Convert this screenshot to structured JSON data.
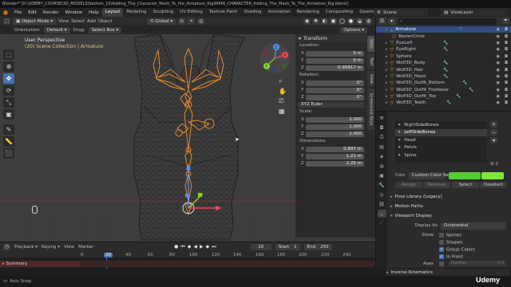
{
  "window": {
    "title": "Blender* [D:\\UDEMY_COURSE\\3D_MODELS\\Section_10\\Adding_The_Character_Mesh_To_the_Armature_Rig\\MAIN_CHARACTER_Adding_The_Mesh_To_The_Armature_Rig.blend]"
  },
  "menus": [
    "File",
    "Edit",
    "Render",
    "Window",
    "Help"
  ],
  "workspaces": [
    "Layout",
    "Modeling",
    "Sculpting",
    "UV Editing",
    "Texture Paint",
    "Shading",
    "Animation",
    "Rendering",
    "Compositing",
    "Geometry Nodes"
  ],
  "scene_name": "Scene",
  "view_layer": "ViewLayer",
  "viewport": {
    "mode": "Object Mode",
    "menus": [
      "View",
      "Select",
      "Add",
      "Object"
    ],
    "transform_orientation": "Global",
    "orientation_label": "Orientation:",
    "orientation_value": "Default",
    "drag_label": "Drag:",
    "drag_value": "Select Box",
    "options": "Options",
    "overlay_title": "User Perspective",
    "overlay_sub": "(20) Scene Collection | Armature",
    "gizmo": {
      "x": "X",
      "y": "Y",
      "z": "Z"
    }
  },
  "npanel": {
    "header": "Transform",
    "location_label": "Location:",
    "location": [
      {
        "axis": "X",
        "value": "0 m"
      },
      {
        "axis": "Y",
        "value": "0 m"
      },
      {
        "axis": "Z",
        "value": "0.95817 m"
      }
    ],
    "rotation_label": "Rotation:",
    "rotation": [
      {
        "axis": "X",
        "value": "0°"
      },
      {
        "axis": "Y",
        "value": "0°"
      },
      {
        "axis": "Z",
        "value": "0°"
      }
    ],
    "rotation_mode": "XYZ Euler",
    "scale_label": "Scale:",
    "scale": [
      {
        "axis": "X",
        "value": "1.000"
      },
      {
        "axis": "Y",
        "value": "1.000"
      },
      {
        "axis": "Z",
        "value": "1.000"
      }
    ],
    "dimensions_label": "Dimensions:",
    "dimensions": [
      {
        "axis": "X",
        "value": "0.897 m"
      },
      {
        "axis": "Y",
        "value": "1.21 m"
      },
      {
        "axis": "Z",
        "value": "2.25 m"
      }
    ],
    "tabs": [
      "Item",
      "Tool",
      "View",
      "Screencast Keys"
    ]
  },
  "outliner": {
    "items": [
      "Armature",
      "BezierCircle",
      "EyeLeft",
      "EyeRight",
      "Sphere",
      "Wolf3D_Body",
      "Wolf3D_Hair",
      "Wolf3D_Head",
      "Wolf3D_Outfit_Bottom",
      "Wolf3D_Outfit_Footwear",
      "Wolf3D_Outfit_Top",
      "Wolf3D_Teeth"
    ],
    "selected_index": 0
  },
  "properties": {
    "bone_groups": [
      "RightSideBones",
      "LeftSideBones",
      "Head",
      "Pelvis",
      "Spine"
    ],
    "selected_group_index": 1,
    "color_label": "Colo",
    "color_set": "Custom Color Set",
    "color_swatch": "#55cc33",
    "buttons": {
      "assign": "Assign",
      "remove": "Remove",
      "select": "Select",
      "deselect": "Deselect"
    },
    "pose_library": "Pose Library (Legacy)",
    "motion_paths": "Motion Paths",
    "viewport_display": "Viewport Display",
    "display_as_label": "Display As",
    "display_as_value": "Octahedral",
    "show_label": "Show",
    "show_items": [
      "Names",
      "Shapes",
      "Group Colors",
      "In Front"
    ],
    "axes_label": "Axes",
    "axes_position": "Position",
    "axes_value": "0.0",
    "inverse_kinematics": "Inverse Kinematics"
  },
  "timeline": {
    "menus": [
      "Playback",
      "Keying",
      "View",
      "Marker"
    ],
    "current_frame": "20",
    "start_label": "Start",
    "start_value": "1",
    "end_label": "End",
    "end_value": "250",
    "ticks": [
      "0",
      "20",
      "40",
      "60",
      "80",
      "100",
      "120",
      "140",
      "160",
      "180",
      "200",
      "220",
      "240"
    ],
    "summary_label": "Summary"
  },
  "status": {
    "text": "Axis Snap"
  },
  "watermark": "Udemy"
}
